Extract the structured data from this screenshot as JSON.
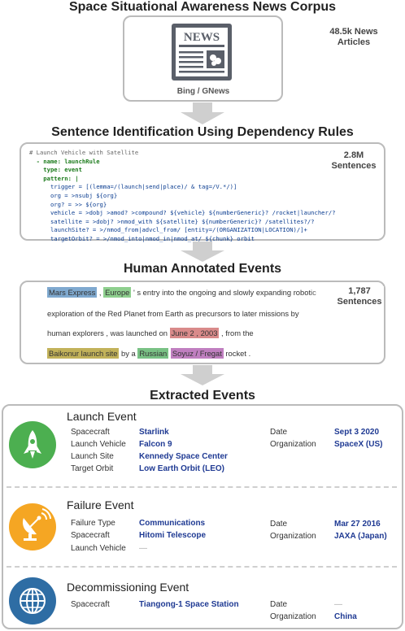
{
  "titles": {
    "corpus": "Space Situational Awareness News Corpus",
    "rules": "Sentence Identification Using Dependency Rules",
    "annotated": "Human Annotated Events",
    "extracted": "Extracted Events"
  },
  "corpus": {
    "newspaper_heading": "NEWS",
    "source": "Bing / GNews",
    "stat_line1": "48.5k News",
    "stat_line2": "Articles"
  },
  "rules": {
    "stat_line1": "2.8M",
    "stat_line2": "Sentences",
    "code_lines": [
      "# Launch Vehicle with Satellite",
      "  - name: launchRule",
      "    type: event",
      "    pattern: |",
      "      trigger = [(lemma=/(launch|send|place)/ & tag=/V.*/)]",
      "      org = >nsubj ${org}",
      "      org? = >> ${org}",
      "      vehicle = >dobj >amod? >compound? ${vehicle} ${numberGeneric}? /rocket|launcher/?",
      "      satellite = >dobj? >nmod_with ${satellite} ${numberGeneric}? /satellites?/?",
      "      launchSite? = >/nmod_from|advcl_from/ [entity=/(ORGANIZATION|LOCATION)/]+",
      "      targetOrbit? = >/nmod_into|nmod_in|nmod_at/ ${chunk} orbit"
    ]
  },
  "annotated": {
    "stat_line1": "1,787",
    "stat_line2": "Sentences",
    "line1_tok1": "Mars Express",
    "line1_sep1": " , ",
    "line1_tok2": "Europe",
    "line1_rest": " ' s entry into the ongoing and slowly expanding robotic",
    "line2": "exploration of the Red Planet from Earth as precursors to later missions by",
    "line3_pre": "human explorers , was launched on ",
    "line3_tok": "June 2 , 2003",
    "line3_post": " , from the",
    "line4_tok1": "Baikonur launch site",
    "line4_mid": " by a ",
    "line4_tok2": "Russian",
    "line4_sp": " ",
    "line4_tok3": "Soyuz / Fregat",
    "line4_post": " rocket ."
  },
  "events": {
    "launch": {
      "title": "Launch Event",
      "icon": "rocket-icon",
      "color": "#4caf50",
      "fields": [
        {
          "label": "Spacecraft",
          "value": "Starlink"
        },
        {
          "label": "Launch Vehicle",
          "value": "Falcon 9"
        },
        {
          "label": "Launch Site",
          "value": "Kennedy Space Center"
        },
        {
          "label": "Target Orbit",
          "value": "Low Earth Orbit (LEO)"
        }
      ],
      "right": [
        {
          "label": "Date",
          "value": "Sept 3 2020"
        },
        {
          "label": "Organization",
          "value": "SpaceX (US)"
        }
      ]
    },
    "failure": {
      "title": "Failure Event",
      "icon": "satellite-dish-icon",
      "color": "#f5a623",
      "fields": [
        {
          "label": "Failure Type",
          "value": "Communications"
        },
        {
          "label": "Spacecraft",
          "value": "Hitomi Telescope"
        },
        {
          "label": "Launch Vehicle",
          "value": "—"
        }
      ],
      "right": [
        {
          "label": "Date",
          "value": "Mar 27 2016"
        },
        {
          "label": "Organization",
          "value": "JAXA (Japan)"
        }
      ]
    },
    "decommissioning": {
      "title": "Decommissioning Event",
      "icon": "globe-icon",
      "color": "#2e6da4",
      "fields": [
        {
          "label": "Spacecraft",
          "value": "Tiangong-1 Space Station"
        }
      ],
      "right": [
        {
          "label": "Date",
          "value": "—"
        },
        {
          "label": "Organization",
          "value": "China"
        }
      ]
    }
  }
}
